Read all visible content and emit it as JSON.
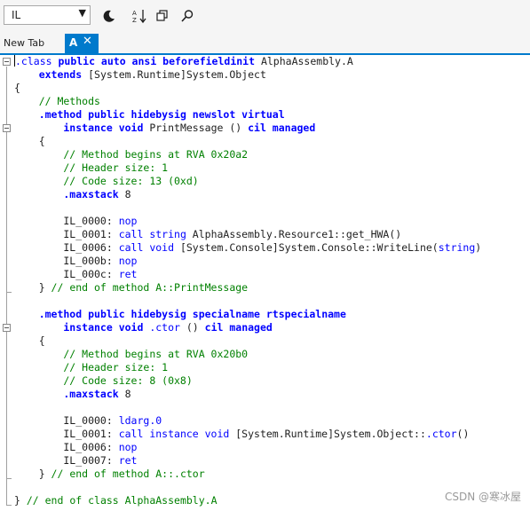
{
  "toolbar": {
    "language_value": "IL",
    "icons": [
      "chevron-down-icon",
      "theme-toggle-icon",
      "sort-icon",
      "copy-icon",
      "search-icon"
    ]
  },
  "tabs": {
    "new_tab_label": "New Tab",
    "active_tab_label": "A",
    "close_glyph": "✕"
  },
  "code_lines": [
    [
      {
        "t": ".class ",
        "c": "kw"
      },
      {
        "t": "public auto ansi beforefieldinit",
        "c": "kwb"
      },
      {
        "t": " AlphaAssembly.A",
        "c": "pl"
      }
    ],
    [
      {
        "t": "    extends",
        "c": "kwb"
      },
      {
        "t": " [System.Runtime]System.Object",
        "c": "pl"
      }
    ],
    [
      {
        "t": "{",
        "c": "pl"
      }
    ],
    [
      {
        "t": "    // Methods",
        "c": "cm"
      }
    ],
    [
      {
        "t": "    .method ",
        "c": "kwb"
      },
      {
        "t": "public hidebysig newslot virtual",
        "c": "kwb"
      }
    ],
    [
      {
        "t": "        instance void",
        "c": "kwb"
      },
      {
        "t": " PrintMessage () ",
        "c": "pl"
      },
      {
        "t": "cil managed",
        "c": "kwb"
      }
    ],
    [
      {
        "t": "    {",
        "c": "pl"
      }
    ],
    [
      {
        "t": "        // Method begins at RVA 0x20a2",
        "c": "cm"
      }
    ],
    [
      {
        "t": "        // Header size: 1",
        "c": "cm"
      }
    ],
    [
      {
        "t": "        // Code size: 13 (0xd)",
        "c": "cm"
      }
    ],
    [
      {
        "t": "        .maxstack",
        "c": "kwb"
      },
      {
        "t": " 8",
        "c": "pl"
      }
    ],
    [
      {
        "t": "",
        "c": "pl"
      }
    ],
    [
      {
        "t": "        IL_0000: ",
        "c": "lb"
      },
      {
        "t": "nop",
        "c": "kw"
      }
    ],
    [
      {
        "t": "        IL_0001: ",
        "c": "lb"
      },
      {
        "t": "call string",
        "c": "kw"
      },
      {
        "t": " AlphaAssembly.Resource1::get_HWA()",
        "c": "pl"
      }
    ],
    [
      {
        "t": "        IL_0006: ",
        "c": "lb"
      },
      {
        "t": "call void",
        "c": "kw"
      },
      {
        "t": " [System.Console]System.Console::WriteLine(",
        "c": "pl"
      },
      {
        "t": "string",
        "c": "kw"
      },
      {
        "t": ")",
        "c": "pl"
      }
    ],
    [
      {
        "t": "        IL_000b: ",
        "c": "lb"
      },
      {
        "t": "nop",
        "c": "kw"
      }
    ],
    [
      {
        "t": "        IL_000c: ",
        "c": "lb"
      },
      {
        "t": "ret",
        "c": "kw"
      }
    ],
    [
      {
        "t": "    } ",
        "c": "pl"
      },
      {
        "t": "// end of method A::PrintMessage",
        "c": "cm"
      }
    ],
    [
      {
        "t": "",
        "c": "pl"
      }
    ],
    [
      {
        "t": "    .method ",
        "c": "kwb"
      },
      {
        "t": "public hidebysig specialname rtspecialname",
        "c": "kwb"
      }
    ],
    [
      {
        "t": "        instance void",
        "c": "kwb"
      },
      {
        "t": " .ctor",
        "c": "kw"
      },
      {
        "t": " () ",
        "c": "pl"
      },
      {
        "t": "cil managed",
        "c": "kwb"
      }
    ],
    [
      {
        "t": "    {",
        "c": "pl"
      }
    ],
    [
      {
        "t": "        // Method begins at RVA 0x20b0",
        "c": "cm"
      }
    ],
    [
      {
        "t": "        // Header size: 1",
        "c": "cm"
      }
    ],
    [
      {
        "t": "        // Code size: 8 (0x8)",
        "c": "cm"
      }
    ],
    [
      {
        "t": "        .maxstack",
        "c": "kwb"
      },
      {
        "t": " 8",
        "c": "pl"
      }
    ],
    [
      {
        "t": "",
        "c": "pl"
      }
    ],
    [
      {
        "t": "        IL_0000: ",
        "c": "lb"
      },
      {
        "t": "ldarg.0",
        "c": "kw"
      }
    ],
    [
      {
        "t": "        IL_0001: ",
        "c": "lb"
      },
      {
        "t": "call instance void",
        "c": "kw"
      },
      {
        "t": " [System.Runtime]System.Object::",
        "c": "pl"
      },
      {
        "t": ".ctor",
        "c": "kw"
      },
      {
        "t": "()",
        "c": "pl"
      }
    ],
    [
      {
        "t": "        IL_0006: ",
        "c": "lb"
      },
      {
        "t": "nop",
        "c": "kw"
      }
    ],
    [
      {
        "t": "        IL_0007: ",
        "c": "lb"
      },
      {
        "t": "ret",
        "c": "kw"
      }
    ],
    [
      {
        "t": "    } ",
        "c": "pl"
      },
      {
        "t": "// end of method A::.ctor",
        "c": "cm"
      }
    ],
    [
      {
        "t": "",
        "c": "pl"
      }
    ],
    [
      {
        "t": "} ",
        "c": "pl"
      },
      {
        "t": "// end of class AlphaAssembly.A",
        "c": "cm"
      }
    ]
  ],
  "watermark": "CSDN @寒冰屋",
  "colors": {
    "keyword": "#0000ff",
    "comment": "#008000",
    "text": "#1e1e1e",
    "accent": "#007acc"
  }
}
